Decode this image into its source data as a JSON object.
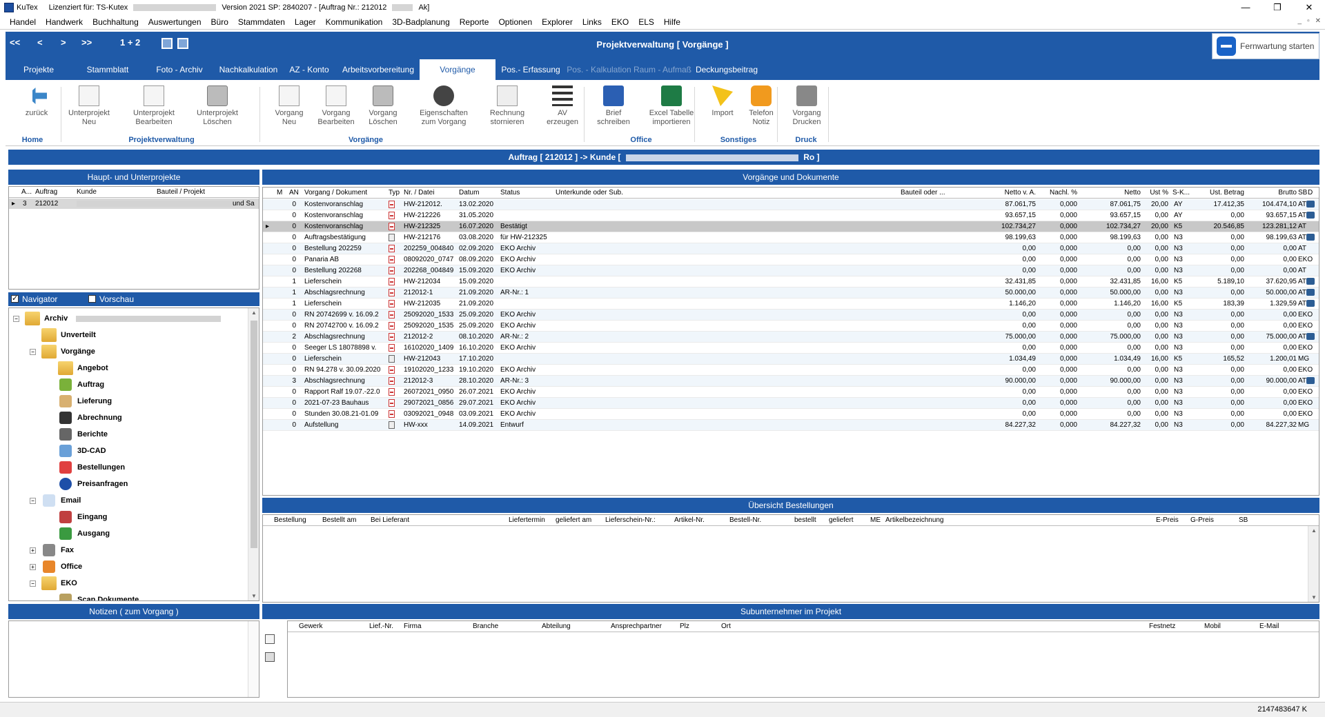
{
  "titlebar": {
    "app_name": "KuTex",
    "license": "Lizenziert für: TS-Kutex",
    "version": "Version 2021 SP: 2840207 - [Auftrag Nr.: 212012",
    "suffix": "Ak]"
  },
  "menu": [
    "Handel",
    "Handwerk",
    "Buchhaltung",
    "Auswertungen",
    "Büro",
    "Stammdaten",
    "Lager",
    "Kommunikation",
    "3D-Badplanung",
    "Reporte",
    "Optionen",
    "Explorer",
    "Links",
    "EKO",
    "ELS",
    "Hilfe"
  ],
  "nav": {
    "first": "<<",
    "prev": "<",
    "next": ">",
    "last": ">>",
    "pages": "1 + 2",
    "title": "Projektverwaltung  [ Vorgänge ]"
  },
  "remote": {
    "label": "Fernwartung starten"
  },
  "tabs": [
    "Projekte",
    "Stammblatt",
    "Foto - Archiv",
    "Nachkalkulation",
    "AZ - Konto",
    "Arbeitsvorbereitung",
    "Vorgänge",
    "Pos.- Erfassung",
    "Pos. - Kalkulation",
    "Raum - Aufmaß",
    "Deckungsbeitrag"
  ],
  "ribbon": {
    "buttons": [
      {
        "l1": "zurück",
        "l2": "",
        "icon": "back-arrow-icon"
      },
      {
        "l1": "Unterprojekt",
        "l2": "Neu",
        "icon": "new-subproject-icon"
      },
      {
        "l1": "Unterprojekt",
        "l2": "Bearbeiten",
        "icon": "edit-subproject-icon"
      },
      {
        "l1": "Unterprojekt",
        "l2": "Löschen",
        "icon": "delete-subproject-icon"
      },
      {
        "l1": "Vorgang",
        "l2": "Neu",
        "icon": "new-process-icon"
      },
      {
        "l1": "Vorgang",
        "l2": "Bearbeiten",
        "icon": "edit-process-icon"
      },
      {
        "l1": "Vorgang",
        "l2": "Löschen",
        "icon": "delete-process-icon"
      },
      {
        "l1": "Eigenschaften",
        "l2": "zum Vorgang",
        "icon": "gear-icon"
      },
      {
        "l1": "Rechnung",
        "l2": "stornieren",
        "icon": "cancel-invoice-icon"
      },
      {
        "l1": "AV",
        "l2": "erzeugen",
        "icon": "list-icon"
      },
      {
        "l1": "Brief",
        "l2": "schreiben",
        "icon": "word-icon"
      },
      {
        "l1": "Excel Tabelle",
        "l2": "importieren",
        "icon": "excel-icon"
      },
      {
        "l1": "Import",
        "l2": "",
        "icon": "eko-icon"
      },
      {
        "l1": "Telefon",
        "l2": "Notiz",
        "icon": "phone-icon"
      },
      {
        "l1": "Vorgang",
        "l2": "Drucken",
        "icon": "printer-icon"
      }
    ],
    "groups": [
      "Home",
      "Projektverwaltung",
      "Vorgänge",
      "Office",
      "Sonstiges",
      "Druck"
    ]
  },
  "order_bar": {
    "prefix": "Auftrag [ 212012 ] -> Kunde [",
    "suffix": "Ro ]"
  },
  "panels": {
    "projects": "Haupt- und Unterprojekte",
    "documents": "Vorgänge und Dokumente",
    "orders": "Übersicht Bestellungen",
    "notes": "Notizen ( zum Vorgang )",
    "subcontractors": "Subunternehmer im Projekt"
  },
  "project_grid": {
    "headers": [
      "A...",
      "Auftrag",
      "Kunde",
      "Bauteil / Projekt"
    ],
    "row": {
      "a": "3",
      "auftrag": "212012",
      "bauteil": "und Sa"
    }
  },
  "navigator": {
    "navigator_label": "Navigator",
    "preview_label": "Vorschau",
    "navigator_checked": true,
    "preview_checked": false
  },
  "tree": [
    {
      "label": "Archiv",
      "level": 0,
      "exp": "−",
      "icon": "folder-icon"
    },
    {
      "label": "Unverteilt",
      "level": 1,
      "exp": "",
      "icon": "unassigned-folder-icon"
    },
    {
      "label": "Vorgänge",
      "level": 1,
      "exp": "−",
      "icon": "folder-icon"
    },
    {
      "label": "Angebot",
      "level": 2,
      "exp": "",
      "icon": "offer-icon"
    },
    {
      "label": "Auftrag",
      "level": 2,
      "exp": "",
      "icon": "order-icon"
    },
    {
      "label": "Lieferung",
      "level": 2,
      "exp": "",
      "icon": "delivery-icon"
    },
    {
      "label": "Abrechnung",
      "level": 2,
      "exp": "",
      "icon": "billing-icon"
    },
    {
      "label": "Berichte",
      "level": 2,
      "exp": "",
      "icon": "reports-icon"
    },
    {
      "label": "3D-CAD",
      "level": 2,
      "exp": "",
      "icon": "cad-icon"
    },
    {
      "label": "Bestellungen",
      "level": 2,
      "exp": "",
      "icon": "purchase-orders-icon"
    },
    {
      "label": "Preisanfragen",
      "level": 2,
      "exp": "",
      "icon": "question-icon"
    },
    {
      "label": "Email",
      "level": 1,
      "exp": "−",
      "icon": "email-icon"
    },
    {
      "label": "Eingang",
      "level": 2,
      "exp": "",
      "icon": "inbox-icon"
    },
    {
      "label": "Ausgang",
      "level": 2,
      "exp": "",
      "icon": "outbox-icon"
    },
    {
      "label": "Fax",
      "level": 1,
      "exp": "+",
      "icon": "fax-icon"
    },
    {
      "label": "Office",
      "level": 1,
      "exp": "+",
      "icon": "office-icon"
    },
    {
      "label": "EKO",
      "level": 1,
      "exp": "−",
      "icon": "folder-icon"
    },
    {
      "label": "Scan Dokumente",
      "level": 2,
      "exp": "",
      "icon": "scan-icon"
    }
  ],
  "doc_grid": {
    "headers": [
      "M",
      "AN",
      "Vorgang / Dokument",
      "Typ",
      "Nr. / Datei",
      "Datum",
      "Status",
      "Unterkunde oder Sub.",
      "Bauteil oder ...",
      "Netto v. A.",
      "Nachl. %",
      "Netto",
      "Ust %",
      "S-K...",
      "Ust. Betrag",
      "Brutto",
      "SB",
      "D"
    ],
    "rows": [
      {
        "an": "0",
        "vorgang": "Kostenvoranschlag",
        "typ": "pdf",
        "nr": "HW-212012.",
        "datum": "13.02.2020",
        "status": "",
        "sub": "",
        "netto_va": "87.061,75",
        "nachl": "0,000",
        "netto": "87.061,75",
        "ust": "20,00",
        "sk": "AY",
        "ust_betrag": "17.412,35",
        "brutto": "104.474,10",
        "sb": "AT",
        "print": true
      },
      {
        "an": "0",
        "vorgang": "Kostenvoranschlag",
        "typ": "pdf",
        "nr": "HW-212226",
        "datum": "31.05.2020",
        "status": "",
        "sub": "",
        "netto_va": "93.657,15",
        "nachl": "0,000",
        "netto": "93.657,15",
        "ust": "0,00",
        "sk": "AY",
        "ust_betrag": "0,00",
        "brutto": "93.657,15",
        "sb": "AT",
        "print": true
      },
      {
        "an": "0",
        "vorgang": "Kostenvoranschlag",
        "typ": "pdf",
        "nr": "HW-212325",
        "datum": "16.07.2020",
        "status": "Bestätigt",
        "sub": "",
        "netto_va": "102.734,27",
        "nachl": "0,000",
        "netto": "102.734,27",
        "ust": "20,00",
        "sk": "K5",
        "ust_betrag": "20.546,85",
        "brutto": "123.281,12",
        "sb": "AT",
        "print": false,
        "selected": true
      },
      {
        "an": "0",
        "vorgang": "Auftragsbestätigung",
        "typ": "doc",
        "nr": "HW-212176",
        "datum": "03.08.2020",
        "status": "für HW-212325",
        "sub": "",
        "netto_va": "98.199,63",
        "nachl": "0,000",
        "netto": "98.199,63",
        "ust": "0,00",
        "sk": "N3",
        "ust_betrag": "0,00",
        "brutto": "98.199,63",
        "sb": "AT",
        "print": true
      },
      {
        "an": "0",
        "vorgang": "Bestellung 202259",
        "typ": "pdf",
        "nr": "202259_004840",
        "datum": "02.09.2020",
        "status": "EKO Archiv",
        "sub": "",
        "netto_va": "0,00",
        "nachl": "0,000",
        "netto": "0,00",
        "ust": "0,00",
        "sk": "N3",
        "ust_betrag": "0,00",
        "brutto": "0,00",
        "sb": "AT",
        "print": false
      },
      {
        "an": "0",
        "vorgang": "Panaria AB",
        "typ": "pdf",
        "nr": "08092020_0747",
        "datum": "08.09.2020",
        "status": "EKO Archiv",
        "sub": "",
        "netto_va": "0,00",
        "nachl": "0,000",
        "netto": "0,00",
        "ust": "0,00",
        "sk": "N3",
        "ust_betrag": "0,00",
        "brutto": "0,00",
        "sb": "EKO",
        "print": false
      },
      {
        "an": "0",
        "vorgang": "Bestellung 202268",
        "typ": "pdf",
        "nr": "202268_004849",
        "datum": "15.09.2020",
        "status": "EKO Archiv",
        "sub": "",
        "netto_va": "0,00",
        "nachl": "0,000",
        "netto": "0,00",
        "ust": "0,00",
        "sk": "N3",
        "ust_betrag": "0,00",
        "brutto": "0,00",
        "sb": "AT",
        "print": false
      },
      {
        "an": "1",
        "vorgang": "Lieferschein",
        "typ": "pdf",
        "nr": "HW-212034",
        "datum": "15.09.2020",
        "status": "",
        "sub": "",
        "netto_va": "32.431,85",
        "nachl": "0,000",
        "netto": "32.431,85",
        "ust": "16,00",
        "sk": "K5",
        "ust_betrag": "5.189,10",
        "brutto": "37.620,95",
        "sb": "AT",
        "print": true
      },
      {
        "an": "1",
        "vorgang": "Abschlagsrechnung",
        "typ": "pdf",
        "nr": "212012-1",
        "datum": "21.09.2020",
        "status": "AR-Nr.: 1",
        "sub": "",
        "netto_va": "50.000,00",
        "nachl": "0,000",
        "netto": "50.000,00",
        "ust": "0,00",
        "sk": "N3",
        "ust_betrag": "0,00",
        "brutto": "50.000,00",
        "sb": "AT",
        "print": true
      },
      {
        "an": "1",
        "vorgang": "Lieferschein",
        "typ": "pdf",
        "nr": "HW-212035",
        "datum": "21.09.2020",
        "status": "",
        "sub": "",
        "netto_va": "1.146,20",
        "nachl": "0,000",
        "netto": "1.146,20",
        "ust": "16,00",
        "sk": "K5",
        "ust_betrag": "183,39",
        "brutto": "1.329,59",
        "sb": "AT",
        "print": true
      },
      {
        "an": "0",
        "vorgang": "RN 20742699 v. 16.09.2",
        "typ": "pdf",
        "nr": "25092020_1533",
        "datum": "25.09.2020",
        "status": "EKO Archiv",
        "sub": "",
        "netto_va": "0,00",
        "nachl": "0,000",
        "netto": "0,00",
        "ust": "0,00",
        "sk": "N3",
        "ust_betrag": "0,00",
        "brutto": "0,00",
        "sb": "EKO",
        "print": false
      },
      {
        "an": "0",
        "vorgang": "RN 20742700 v. 16.09.2",
        "typ": "pdf",
        "nr": "25092020_1535",
        "datum": "25.09.2020",
        "status": "EKO Archiv",
        "sub": "",
        "netto_va": "0,00",
        "nachl": "0,000",
        "netto": "0,00",
        "ust": "0,00",
        "sk": "N3",
        "ust_betrag": "0,00",
        "brutto": "0,00",
        "sb": "EKO",
        "print": false
      },
      {
        "an": "2",
        "vorgang": "Abschlagsrechnung",
        "typ": "pdf",
        "nr": "212012-2",
        "datum": "08.10.2020",
        "status": "AR-Nr.: 2",
        "sub": "",
        "netto_va": "75.000,00",
        "nachl": "0,000",
        "netto": "75.000,00",
        "ust": "0,00",
        "sk": "N3",
        "ust_betrag": "0,00",
        "brutto": "75.000,00",
        "sb": "AT",
        "print": true
      },
      {
        "an": "0",
        "vorgang": "Seeger LS 18078898 v.",
        "typ": "pdf",
        "nr": "16102020_1409",
        "datum": "16.10.2020",
        "status": "EKO Archiv",
        "sub": "",
        "netto_va": "0,00",
        "nachl": "0,000",
        "netto": "0,00",
        "ust": "0,00",
        "sk": "N3",
        "ust_betrag": "0,00",
        "brutto": "0,00",
        "sb": "EKO",
        "print": false
      },
      {
        "an": "0",
        "vorgang": "Lieferschein",
        "typ": "doc",
        "nr": "HW-212043",
        "datum": "17.10.2020",
        "status": "",
        "sub": "",
        "netto_va": "1.034,49",
        "nachl": "0,000",
        "netto": "1.034,49",
        "ust": "16,00",
        "sk": "K5",
        "ust_betrag": "165,52",
        "brutto": "1.200,01",
        "sb": "MG",
        "print": false
      },
      {
        "an": "0",
        "vorgang": "RN 94.278 v. 30.09.2020",
        "typ": "pdf",
        "nr": "19102020_1233",
        "datum": "19.10.2020",
        "status": "EKO Archiv",
        "sub": "",
        "netto_va": "0,00",
        "nachl": "0,000",
        "netto": "0,00",
        "ust": "0,00",
        "sk": "N3",
        "ust_betrag": "0,00",
        "brutto": "0,00",
        "sb": "EKO",
        "print": false
      },
      {
        "an": "3",
        "vorgang": "Abschlagsrechnung",
        "typ": "pdf",
        "nr": "212012-3",
        "datum": "28.10.2020",
        "status": "AR-Nr.: 3",
        "sub": "",
        "netto_va": "90.000,00",
        "nachl": "0,000",
        "netto": "90.000,00",
        "ust": "0,00",
        "sk": "N3",
        "ust_betrag": "0,00",
        "brutto": "90.000,00",
        "sb": "AT",
        "print": true
      },
      {
        "an": "0",
        "vorgang": "Rapport Ralf 19.07.-22.0",
        "typ": "pdf",
        "nr": "26072021_0950",
        "datum": "26.07.2021",
        "status": "EKO Archiv",
        "sub": "",
        "netto_va": "0,00",
        "nachl": "0,000",
        "netto": "0,00",
        "ust": "0,00",
        "sk": "N3",
        "ust_betrag": "0,00",
        "brutto": "0,00",
        "sb": "EKO",
        "print": false
      },
      {
        "an": "0",
        "vorgang": "2021-07-23 Bauhaus",
        "typ": "pdf",
        "nr": "29072021_0856",
        "datum": "29.07.2021",
        "status": "EKO Archiv",
        "sub": "",
        "netto_va": "0,00",
        "nachl": "0,000",
        "netto": "0,00",
        "ust": "0,00",
        "sk": "N3",
        "ust_betrag": "0,00",
        "brutto": "0,00",
        "sb": "EKO",
        "print": false
      },
      {
        "an": "0",
        "vorgang": "Stunden 30.08.21-01.09",
        "typ": "pdf",
        "nr": "03092021_0948",
        "datum": "03.09.2021",
        "status": "EKO Archiv",
        "sub": "",
        "netto_va": "0,00",
        "nachl": "0,000",
        "netto": "0,00",
        "ust": "0,00",
        "sk": "N3",
        "ust_betrag": "0,00",
        "brutto": "0,00",
        "sb": "EKO",
        "print": false
      },
      {
        "an": "0",
        "vorgang": "Aufstellung",
        "typ": "doc",
        "nr": "HW-xxx",
        "datum": "14.09.2021",
        "status": "Entwurf",
        "sub": "",
        "netto_va": "84.227,32",
        "nachl": "0,000",
        "netto": "84.227,32",
        "ust": "0,00",
        "sk": "N3",
        "ust_betrag": "0,00",
        "brutto": "84.227,32",
        "sb": "MG",
        "print": false
      }
    ]
  },
  "orders_grid": {
    "headers": [
      "Bestellung",
      "Bestellt am",
      "Bei Lieferant",
      "Liefertermin",
      "geliefert am",
      "Lieferschein-Nr.:",
      "Artikel-Nr.",
      "Bestell-Nr.",
      "bestellt",
      "geliefert",
      "ME",
      "Artikelbezeichnung",
      "E-Preis",
      "G-Preis",
      "SB"
    ]
  },
  "subs_grid": {
    "headers": [
      "Gewerk",
      "Lief.-Nr.",
      "Firma",
      "Branche",
      "Abteilung",
      "Ansprechpartner",
      "Plz",
      "Ort",
      "Festnetz",
      "Mobil",
      "E-Mail"
    ]
  },
  "status": {
    "memory": "2147483647 K"
  }
}
